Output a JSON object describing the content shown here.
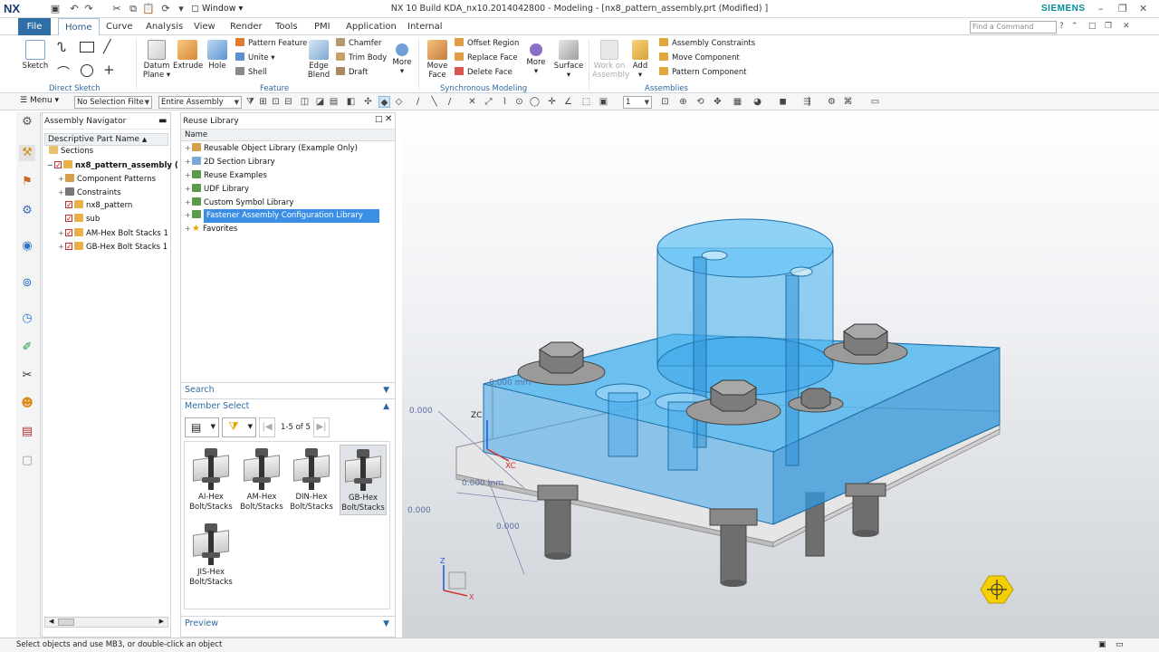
{
  "window": {
    "logo": "NX",
    "title": "NX 10  Build KDA_nx10.2014042800 - Modeling - [nx8_pattern_assembly.prt (Modified) ]",
    "brand": "SIEMENS",
    "window_menu": "Window",
    "controls": [
      "–",
      "❐",
      "✕"
    ]
  },
  "menu": {
    "file": "File",
    "tabs": [
      "Home",
      "Curve",
      "Analysis",
      "View",
      "Render",
      "Tools",
      "PMI",
      "Application",
      "Internal"
    ],
    "active_tab": "Home",
    "command_finder_placeholder": "Find a Command"
  },
  "ribbon": {
    "sketch": "Sketch",
    "datum_plane": [
      "Datum",
      "Plane ▾"
    ],
    "extrude": "Extrude",
    "hole": "Hole",
    "pattern_feature": "Pattern Feature",
    "unite": "Unite",
    "shell": "Shell",
    "edge_blend": [
      "Edge",
      "Blend"
    ],
    "chamfer": "Chamfer",
    "trim_body": "Trim Body",
    "draft": "Draft",
    "more": "More",
    "move_face": [
      "Move",
      "Face"
    ],
    "offset_region": "Offset Region",
    "replace_face": "Replace Face",
    "delete_face": "Delete Face",
    "more2": "More",
    "surface": "Surface",
    "work_on_assembly": [
      "Work on",
      "Assembly"
    ],
    "add": "Add",
    "assembly_constraints": "Assembly Constraints",
    "move_component": "Move Component",
    "pattern_component": "Pattern Component",
    "groups": [
      "Direct Sketch",
      "Feature",
      "Synchronous Modeling",
      "Assemblies"
    ]
  },
  "selection_bar": {
    "menu": "Menu",
    "filter": "No Selection Filte",
    "scope": "Entire Assembly",
    "layer": "1"
  },
  "assembly_navigator": {
    "title": "Assembly Navigator",
    "column": "Descriptive Part Name",
    "nodes": [
      {
        "label": "Sections",
        "level": 0
      },
      {
        "label": "nx8_pattern_assembly (",
        "level": 0
      },
      {
        "label": "Component Patterns",
        "level": 1
      },
      {
        "label": "Constraints",
        "level": 1
      },
      {
        "label": "nx8_pattern",
        "level": 1
      },
      {
        "label": "sub",
        "level": 1
      },
      {
        "label": "AM-Hex Bolt Stacks 1",
        "level": 1
      },
      {
        "label": "GB-Hex Bolt Stacks 1",
        "level": 1
      }
    ]
  },
  "reuse_library": {
    "title": "Reuse Library",
    "column": "Name",
    "items": [
      "Reusable Object Library (Example Only)",
      "2D Section Library",
      "Reuse Examples",
      "UDF Library",
      "Custom Symbol Library",
      "Fastener Assembly Configuration Library",
      "Favorites"
    ],
    "selected_item": "Fastener Assembly Configuration Library",
    "search": "Search",
    "member_select": "Member Select",
    "pagination": "1-5 of 5",
    "members": [
      {
        "line1": "AI-Hex",
        "line2": "Bolt/Stacks"
      },
      {
        "line1": "AM-Hex",
        "line2": "Bolt/Stacks"
      },
      {
        "line1": "DIN-Hex",
        "line2": "Bolt/Stacks"
      },
      {
        "line1": "GB-Hex",
        "line2": "Bolt/Stacks"
      },
      {
        "line1": "JIS-Hex",
        "line2": "Bolt/Stacks"
      }
    ],
    "preview": "Preview"
  },
  "viewport": {
    "dims": [
      "0.000 mm",
      "0.000",
      "0.000 mm",
      "0.000",
      "0.000"
    ],
    "axes": [
      "ZC",
      "XC",
      "Z",
      "X"
    ]
  },
  "status": {
    "text": "Select objects and use MB3, or double-click an object"
  },
  "colors": {
    "accent": "#2f6ea6",
    "selection": "#3a8ee6",
    "part_blue": "#3ea6e8"
  }
}
